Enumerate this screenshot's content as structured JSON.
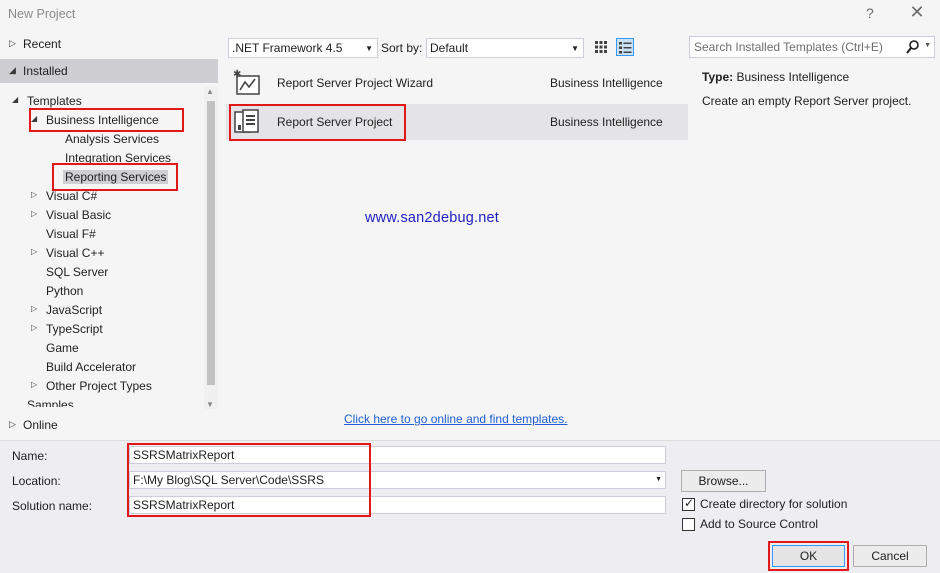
{
  "window": {
    "title": "New Project",
    "help": "?",
    "close": "✕"
  },
  "sidebar": {
    "recent": "Recent",
    "installed": "Installed",
    "online": "Online",
    "tree": [
      {
        "label": "Templates",
        "indent": 0,
        "twisty": "open"
      },
      {
        "label": "Business Intelligence",
        "indent": 1,
        "twisty": "open"
      },
      {
        "label": "Analysis Services",
        "indent": 2,
        "twisty": ""
      },
      {
        "label": "Integration Services",
        "indent": 2,
        "twisty": ""
      },
      {
        "label": "Reporting Services",
        "indent": 2,
        "twisty": "",
        "selected": true
      },
      {
        "label": "Visual C#",
        "indent": 1,
        "twisty": "closed"
      },
      {
        "label": "Visual Basic",
        "indent": 1,
        "twisty": "closed"
      },
      {
        "label": "Visual F#",
        "indent": 1,
        "twisty": ""
      },
      {
        "label": "Visual C++",
        "indent": 1,
        "twisty": "closed"
      },
      {
        "label": "SQL Server",
        "indent": 1,
        "twisty": ""
      },
      {
        "label": "Python",
        "indent": 1,
        "twisty": ""
      },
      {
        "label": "JavaScript",
        "indent": 1,
        "twisty": "closed"
      },
      {
        "label": "TypeScript",
        "indent": 1,
        "twisty": "closed"
      },
      {
        "label": "Game",
        "indent": 1,
        "twisty": ""
      },
      {
        "label": "Build Accelerator",
        "indent": 1,
        "twisty": ""
      },
      {
        "label": "Other Project Types",
        "indent": 1,
        "twisty": "closed"
      },
      {
        "label": "Samples",
        "indent": 0,
        "twisty": ""
      }
    ]
  },
  "toolbar": {
    "framework": ".NET Framework 4.5",
    "sort_label": "Sort by:",
    "sort_value": "Default"
  },
  "search": {
    "placeholder": "Search Installed Templates (Ctrl+E)"
  },
  "templates": [
    {
      "name": "Report Server Project Wizard",
      "category": "Business Intelligence",
      "icon": "wizard-icon"
    },
    {
      "name": "Report Server Project",
      "category": "Business Intelligence",
      "icon": "report-project-icon",
      "selected": true
    }
  ],
  "watermark": "www.san2debug.net",
  "online_link": "Click here to go online and find templates.",
  "details": {
    "type_label": "Type:",
    "type_value": "Business Intelligence",
    "description": "Create an empty Report Server project."
  },
  "form": {
    "name_label": "Name:",
    "name_value": "SSRSMatrixReport",
    "location_label": "Location:",
    "location_value": "F:\\My Blog\\SQL Server\\Code\\SSRS",
    "solution_label": "Solution name:",
    "solution_value": "SSRSMatrixReport",
    "browse_label": "Browse...",
    "create_dir_label": "Create directory for solution",
    "create_dir_checked": true,
    "source_control_label": "Add to Source Control",
    "source_control_checked": false,
    "ok_label": "OK",
    "cancel_label": "Cancel"
  },
  "colors": {
    "annotation": "#e01818",
    "selection": "#cfcfd3",
    "link": "#1f5fd3",
    "watermark": "#2020c0"
  }
}
